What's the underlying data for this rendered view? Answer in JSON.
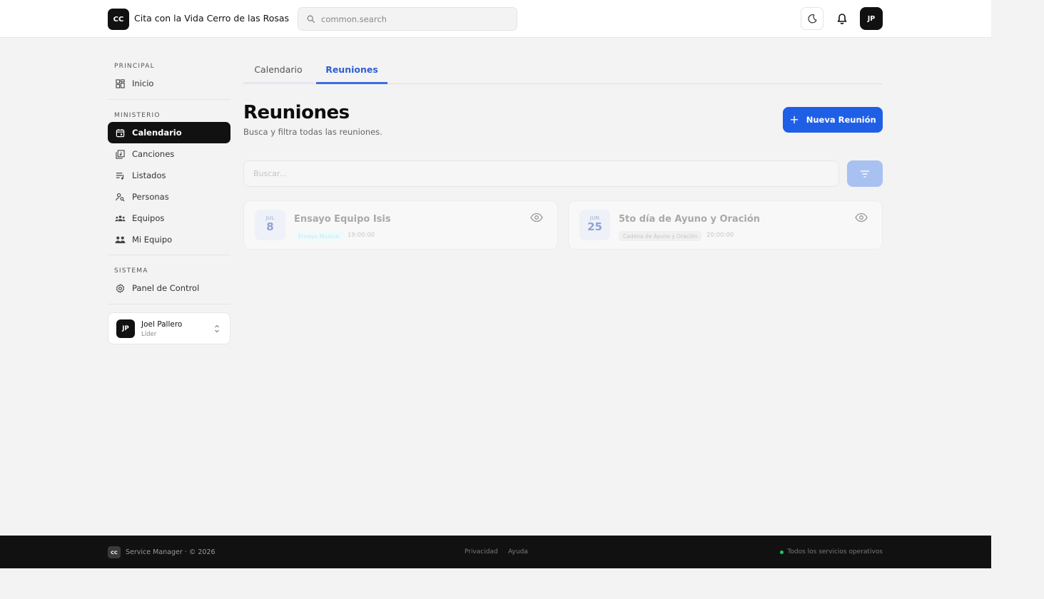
{
  "header": {
    "logo_text": "CC",
    "org_name": "Cita con la Vida Cerro de las Rosas",
    "search_placeholder": "common.search",
    "avatar_initials": "JP"
  },
  "sidebar": {
    "sections": [
      {
        "label": "PRINCIPAL",
        "items": [
          {
            "label": "Inicio",
            "icon": "dashboard-icon"
          }
        ]
      },
      {
        "label": "MINISTERIO",
        "items": [
          {
            "label": "Calendario",
            "icon": "calendar-icon",
            "active": true
          },
          {
            "label": "Canciones",
            "icon": "music-library-icon"
          },
          {
            "label": "Listados",
            "icon": "playlist-icon"
          },
          {
            "label": "Personas",
            "icon": "person-search-icon"
          },
          {
            "label": "Equipos",
            "icon": "groups-icon"
          },
          {
            "label": "Mi Equipo",
            "icon": "my-team-icon"
          }
        ]
      },
      {
        "label": "SISTEMA",
        "items": [
          {
            "label": "Panel de Control",
            "icon": "settings-icon"
          }
        ]
      }
    ],
    "user": {
      "initials": "JP",
      "name": "Joel Pallero",
      "role": "Líder"
    }
  },
  "tabs": [
    {
      "label": "Calendario",
      "active": false
    },
    {
      "label": "Reuniones",
      "active": true
    }
  ],
  "main": {
    "title": "Reuniones",
    "subtitle": "Busca y filtra todas las reuniones.",
    "new_button_label": "Nueva Reunión",
    "search_placeholder": "Buscar..."
  },
  "meetings": [
    {
      "month": "JUL",
      "day": "8",
      "title": "Ensayo Equipo Isis",
      "type": "Ensayo Musical",
      "type_color": "#bfe9f0",
      "type_bg": "#f1fafb",
      "time": "19:00:00"
    },
    {
      "month": "JUN",
      "day": "25",
      "title": "5to día de Ayuno y Oración",
      "type": "Cadena de Ayuno y Oración",
      "type_color": "#c7c7c7",
      "type_bg": "#f0f0f0",
      "time": "20:00:00"
    }
  ],
  "footer": {
    "logo_text": "CC",
    "copyright": "Service Manager · © 2026",
    "links": [
      "Privacidad",
      "Ayuda"
    ],
    "status": "Todos los servicios operativos"
  },
  "colors": {
    "accent": "#1f5fe6",
    "active_nav": "#111111",
    "status_ok": "#22c55e"
  }
}
